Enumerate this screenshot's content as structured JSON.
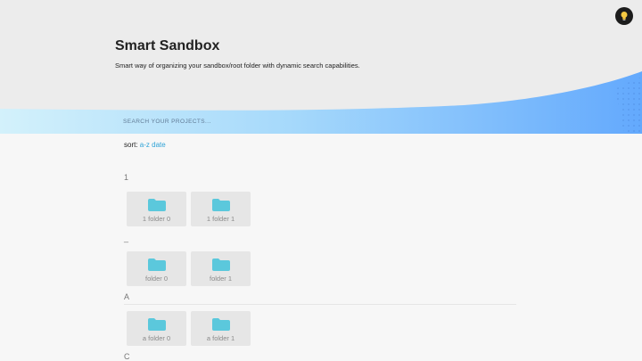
{
  "header": {
    "title": "Smart Sandbox",
    "subtitle": "Smart way of organizing your sandbox/root folder with dynamic search capabilities."
  },
  "theme_toggle": {
    "icon": "lightbulb-icon"
  },
  "search": {
    "placeholder": "SEARCH YOUR PROJECTS..."
  },
  "sort": {
    "label": "sort:",
    "options": [
      "a-z",
      "date"
    ]
  },
  "groups": [
    {
      "label": "1",
      "folders": [
        "1 folder 0",
        "1 folder 1"
      ]
    },
    {
      "label": "_",
      "folders": [
        "folder 0",
        "folder 1"
      ]
    },
    {
      "label": "A",
      "folders": [
        "a folder 0",
        "a folder 1"
      ]
    },
    {
      "label": "C",
      "folders": []
    }
  ],
  "colors": {
    "accent": "#2fa3d7",
    "folder": "#5bc8dc",
    "wave_light": "#cdeefb",
    "wave_dark": "#6aaefc"
  }
}
